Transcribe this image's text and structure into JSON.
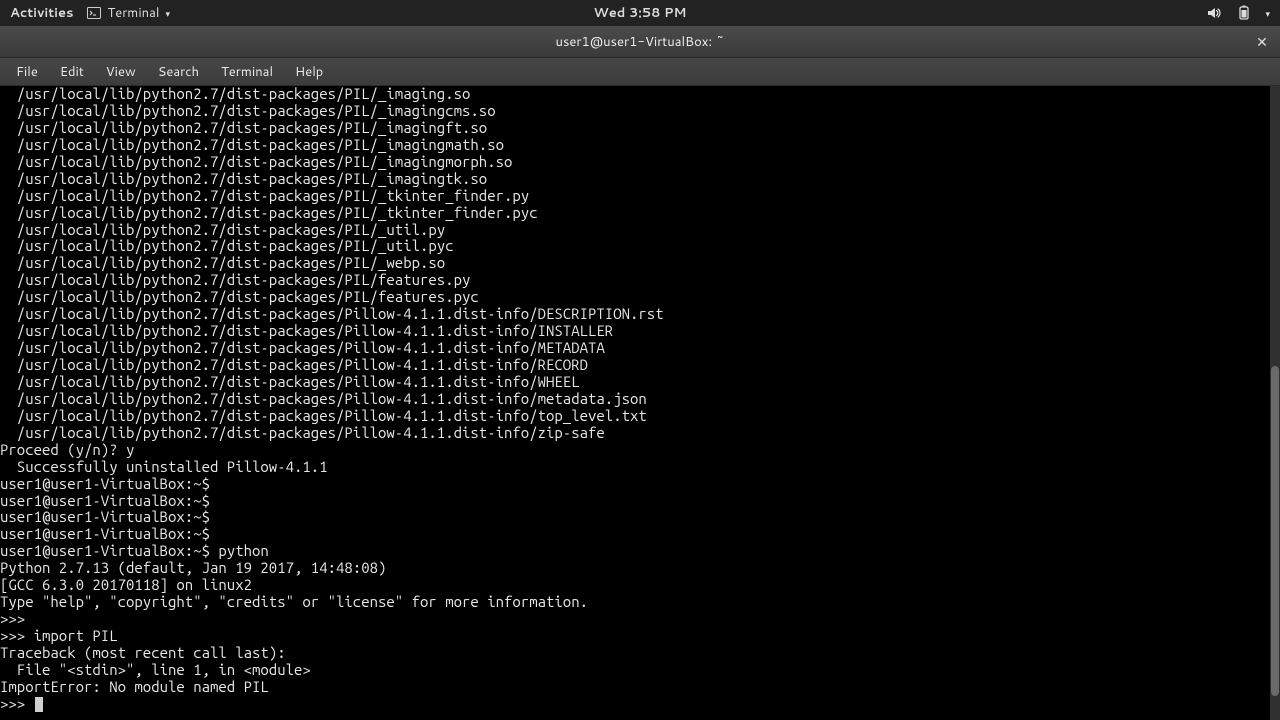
{
  "topbar": {
    "activities": "Activities",
    "app_name": "Terminal",
    "clock": "Wed  3:58 PM"
  },
  "window": {
    "title": "user1@user1-VirtualBox: ~"
  },
  "menubar": [
    "File",
    "Edit",
    "View",
    "Search",
    "Terminal",
    "Help"
  ],
  "terminal": {
    "prompt": "user1@user1-VirtualBox:~$",
    "lines": [
      "  /usr/local/lib/python2.7/dist-packages/PIL/_imaging.so",
      "  /usr/local/lib/python2.7/dist-packages/PIL/_imagingcms.so",
      "  /usr/local/lib/python2.7/dist-packages/PIL/_imagingft.so",
      "  /usr/local/lib/python2.7/dist-packages/PIL/_imagingmath.so",
      "  /usr/local/lib/python2.7/dist-packages/PIL/_imagingmorph.so",
      "  /usr/local/lib/python2.7/dist-packages/PIL/_imagingtk.so",
      "  /usr/local/lib/python2.7/dist-packages/PIL/_tkinter_finder.py",
      "  /usr/local/lib/python2.7/dist-packages/PIL/_tkinter_finder.pyc",
      "  /usr/local/lib/python2.7/dist-packages/PIL/_util.py",
      "  /usr/local/lib/python2.7/dist-packages/PIL/_util.pyc",
      "  /usr/local/lib/python2.7/dist-packages/PIL/_webp.so",
      "  /usr/local/lib/python2.7/dist-packages/PIL/features.py",
      "  /usr/local/lib/python2.7/dist-packages/PIL/features.pyc",
      "  /usr/local/lib/python2.7/dist-packages/Pillow-4.1.1.dist-info/DESCRIPTION.rst",
      "  /usr/local/lib/python2.7/dist-packages/Pillow-4.1.1.dist-info/INSTALLER",
      "  /usr/local/lib/python2.7/dist-packages/Pillow-4.1.1.dist-info/METADATA",
      "  /usr/local/lib/python2.7/dist-packages/Pillow-4.1.1.dist-info/RECORD",
      "  /usr/local/lib/python2.7/dist-packages/Pillow-4.1.1.dist-info/WHEEL",
      "  /usr/local/lib/python2.7/dist-packages/Pillow-4.1.1.dist-info/metadata.json",
      "  /usr/local/lib/python2.7/dist-packages/Pillow-4.1.1.dist-info/top_level.txt",
      "  /usr/local/lib/python2.7/dist-packages/Pillow-4.1.1.dist-info/zip-safe",
      "Proceed (y/n)? y",
      "  Successfully uninstalled Pillow-4.1.1",
      "user1@user1-VirtualBox:~$ ",
      "user1@user1-VirtualBox:~$ ",
      "user1@user1-VirtualBox:~$ ",
      "user1@user1-VirtualBox:~$ ",
      "user1@user1-VirtualBox:~$ python",
      "Python 2.7.13 (default, Jan 19 2017, 14:48:08) ",
      "[GCC 6.3.0 20170118] on linux2",
      "Type \"help\", \"copyright\", \"credits\" or \"license\" for more information.",
      ">>> ",
      ">>> import PIL",
      "Traceback (most recent call last):",
      "  File \"<stdin>\", line 1, in <module>",
      "ImportError: No module named PIL",
      ">>> "
    ]
  }
}
